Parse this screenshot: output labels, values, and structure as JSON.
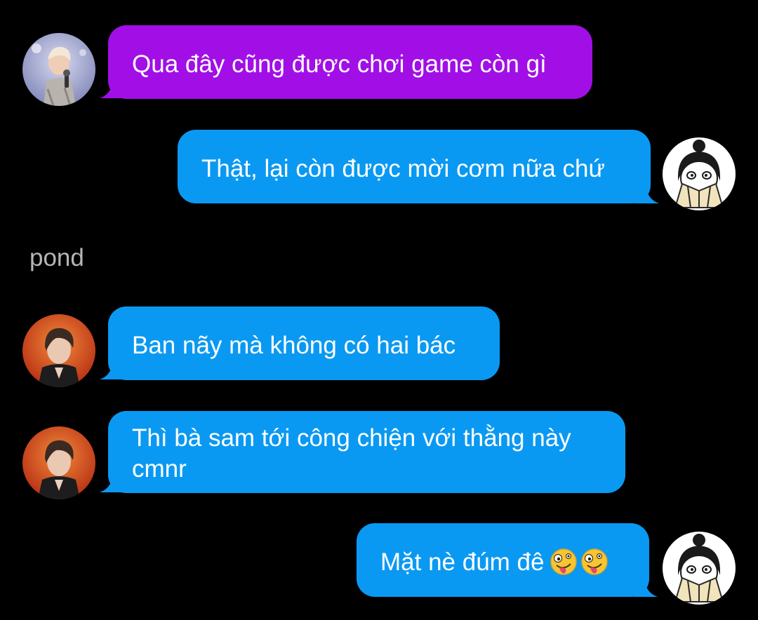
{
  "colors": {
    "background": "#000000",
    "incoming_purple": "#a10fe6",
    "bubble_blue": "#0a99f2",
    "text": "#ffffff",
    "sender_name": "#b6b6b6"
  },
  "messages": [
    {
      "id": 1,
      "direction": "incoming",
      "avatar": "avatar-singer-icon",
      "text": "Qua đây cũng được chơi game còn gì"
    },
    {
      "id": 2,
      "direction": "outgoing",
      "avatar": "avatar-fan-girl-icon",
      "text": "Thật, lại còn được mời cơm nữa chứ"
    },
    {
      "id": 3,
      "direction": "incoming",
      "sender": "pond",
      "avatar": "avatar-pond-icon",
      "text": "Ban nãy mà không có hai bác"
    },
    {
      "id": 4,
      "direction": "incoming",
      "avatar": "avatar-pond-icon",
      "text_line1": "Thì bà sam tới công chiện với thằng này",
      "text_line2": "cmnr"
    },
    {
      "id": 5,
      "direction": "outgoing",
      "avatar": "avatar-fan-girl-icon",
      "text": "Mặt nè đúm đê",
      "emoji": [
        "zany-face-icon",
        "zany-face-icon"
      ]
    }
  ]
}
